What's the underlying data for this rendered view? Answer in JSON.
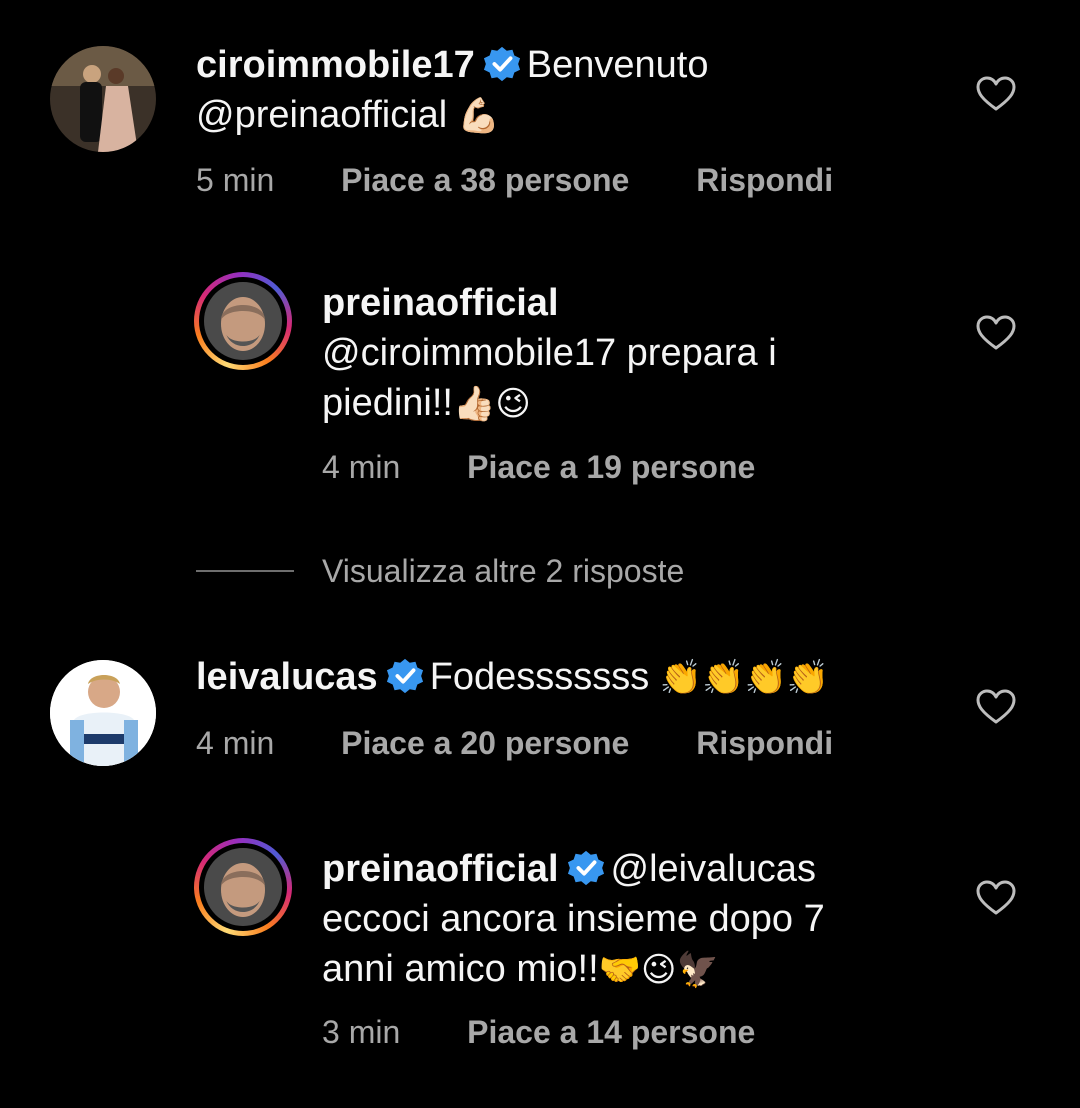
{
  "comments": [
    {
      "username": "ciroimmobile17",
      "verified": true,
      "text_line1": "Benvenuto",
      "text_line2": "@preinaofficial",
      "emoji": "💪🏻",
      "time": "5 min",
      "likes": "Piace a 38 persone",
      "reply": "Rispondi"
    },
    {
      "username": "preinaofficial",
      "verified": false,
      "text_line1": "@ciroimmobile17 prepara i",
      "text_line2": "piedini!!",
      "emoji": "👍🏻😉",
      "time": "4 min",
      "likes": "Piace a 19 persone"
    },
    {
      "username": "leivalucas",
      "verified": true,
      "text_line1": "Fodesssssss",
      "emoji": "👏👏👏👏",
      "time": "4 min",
      "likes": "Piace a 20 persone",
      "reply": "Rispondi"
    },
    {
      "username": "preinaofficial",
      "verified": true,
      "text_line1": "@leivalucas",
      "text_line2": "eccoci ancora insieme dopo 7",
      "text_line3": "anni amico mio!!",
      "emoji": "🤝😉🦅",
      "time": "3 min",
      "likes": "Piace a 14 persone"
    }
  ],
  "view_more": "Visualizza altre 2 risposte",
  "colors": {
    "background": "#000000",
    "text": "#f5f5f5",
    "muted": "#a8a8a8",
    "verified": "#3897f0"
  }
}
